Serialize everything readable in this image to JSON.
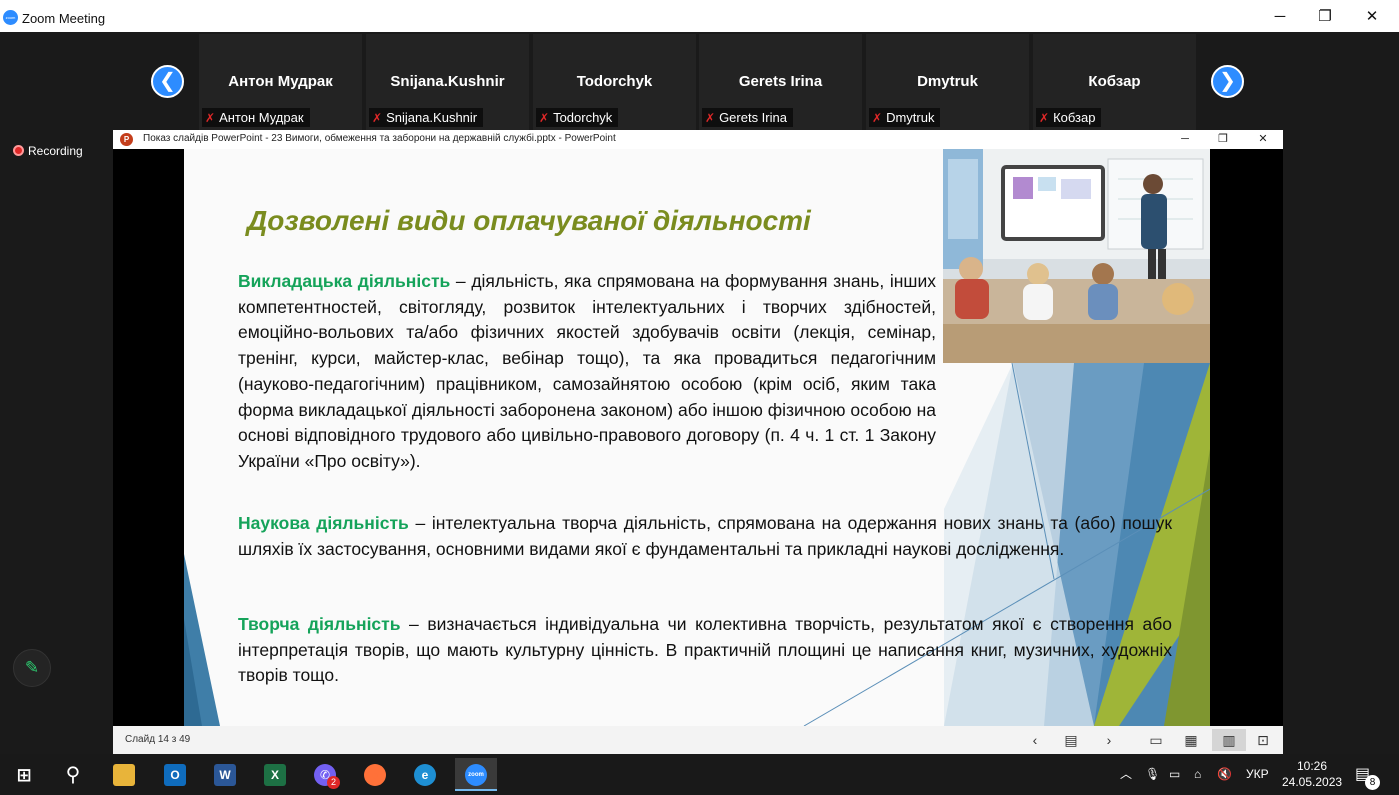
{
  "zoom": {
    "title": "Zoom Meeting",
    "logo_text": "zoom",
    "minimize": "─",
    "restore": "❐",
    "close": "✕",
    "prev_arrow": "❮",
    "next_arrow": "❯"
  },
  "participants": [
    {
      "name": "Антон Мудрак",
      "label": "Антон Мудрак",
      "muted": true
    },
    {
      "name": "Snijana.Kushnir",
      "label": "Snijana.Kushnir",
      "muted": true
    },
    {
      "name": "Todorchyk",
      "label": "Todorchyk",
      "muted": true
    },
    {
      "name": "Gerets Irina",
      "label": "Gerets Irina",
      "muted": true
    },
    {
      "name": "Dmytruk",
      "label": "Dmytruk",
      "muted": true
    },
    {
      "name": "Кобзар",
      "label": "Кобзар",
      "muted": true
    }
  ],
  "recording": {
    "label": "Recording"
  },
  "ppt": {
    "title": "Показ слайдів PowerPoint  -  23 Вимоги, обмеження та заборони на державній службі.pptx - PowerPoint",
    "icon_letter": "P",
    "minimize": "─",
    "restore": "❐",
    "close": "✕",
    "status": {
      "slide_count": "Слайд 14 з 49"
    }
  },
  "slide": {
    "heading": "Дозволені види оплачуваної діяльності",
    "paragraphs": [
      {
        "term": "Викладацька діяльність",
        "text": " – діяльність, яка спрямована на формування знань, інших компетентностей, світогляду, розвиток інтелектуальних і творчих здібностей, емоційно-вольових та/або фізичних якостей здобувачів освіти (лекція, семінар, тренінг, курси, майстер-клас, вебінар тощо), та яка провадиться педагогічним (науково-педагогічним) працівником, самозайнятою особою (крім осіб, яким така форма викладацької діяльності заборонена законом) або іншою фізичною особою на основі відповідного трудового або цивільно-правового договору (п. 4 ч. 1 ст. 1 Закону України «Про освіту»)."
      },
      {
        "term": "Наукова діяльність",
        "text": " – інтелектуальна творча діяльність, спрямована на одержання нових знань та (або) пошук шляхів їх застосування, основними видами якої є фундаментальні та прикладні наукові дослідження."
      },
      {
        "term": "Творча діяльність",
        "text": " – визначається індивідуальна чи колективна творчість, результатом якої є створення або інтерпретація творів, що мають культурну цінність. В практичній площині це написання книг, музичних, художніх творів тощо."
      }
    ]
  },
  "taskbar": {
    "apps": [
      {
        "name": "start",
        "glyph": "⊞",
        "color": "#191919"
      },
      {
        "name": "search",
        "glyph": "⚲",
        "color": "#191919"
      },
      {
        "name": "file-explorer",
        "glyph": "▬",
        "color": "#e8b43a"
      },
      {
        "name": "outlook",
        "glyph": "O",
        "color": "#0f6cbd"
      },
      {
        "name": "word",
        "glyph": "W",
        "color": "#2b5797"
      },
      {
        "name": "excel",
        "glyph": "X",
        "color": "#1d7044"
      },
      {
        "name": "viber",
        "glyph": "✆",
        "color": "#7360f2",
        "badge": "2"
      },
      {
        "name": "firefox",
        "glyph": "●",
        "color": "#ff7139"
      },
      {
        "name": "edge",
        "glyph": "e",
        "color": "#1e8fd3"
      },
      {
        "name": "zoom",
        "glyph": "zoom",
        "color": "#2D8CFF"
      }
    ],
    "tray": {
      "language": "УКР",
      "time": "10:26",
      "date": "24.05.2023",
      "notifications": "8"
    }
  }
}
